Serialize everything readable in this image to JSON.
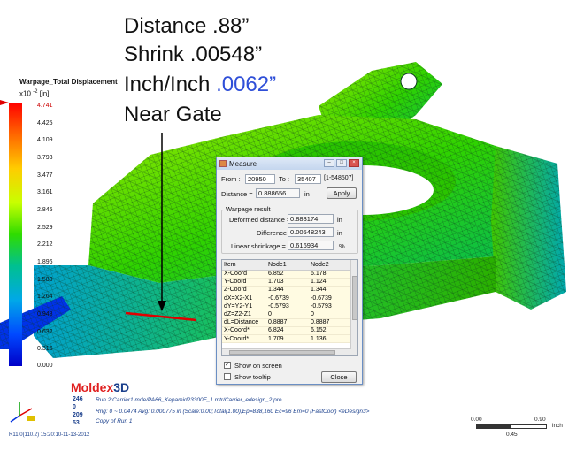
{
  "annotation": {
    "line1": "Distance .88”",
    "line2": "Shrink .00548”",
    "line3_prefix": "Inch/Inch ",
    "line3_highlight": ".0062”",
    "line4": "Near Gate"
  },
  "legend": {
    "title": "Warpage_Total Displacement",
    "unit_prefix": "x10",
    "unit_exp": "-2",
    "unit": "[in]",
    "ticks": [
      "4.741",
      "4.425",
      "4.109",
      "3.793",
      "3.477",
      "3.161",
      "2.845",
      "2.529",
      "2.212",
      "1.896",
      "1.580",
      "1.264",
      "0.948",
      "0.632",
      "0.316",
      "0.000"
    ]
  },
  "dialog": {
    "title": "Measure",
    "from_label": "From :",
    "from_value": "20950",
    "to_label": "To :",
    "to_value": "35407",
    "range_text": "[1-548507]",
    "distance_label": "Distance =",
    "distance_value": "0.888656",
    "distance_unit": "in",
    "apply_label": "Apply",
    "group_title": "Warpage result",
    "deformed_label": "Deformed distance =",
    "deformed_value": "0.883174",
    "deformed_unit": "in",
    "difference_label": "Difference =",
    "difference_value": "0.00548243",
    "difference_unit": "in",
    "shrinkage_label": "Linear shrinkage =",
    "shrinkage_value": "0.616934",
    "shrinkage_unit": "%",
    "table_headers": [
      "Item",
      "Node1",
      "Node2"
    ],
    "table_rows": [
      [
        "X-Coord",
        "6.852",
        "6.178"
      ],
      [
        "Y-Coord",
        "1.703",
        "1.124"
      ],
      [
        "Z-Coord",
        "1.344",
        "1.344"
      ],
      [
        "dX=X2-X1",
        "-0.6739",
        "-0.6739"
      ],
      [
        "dY=Y2-Y1",
        "-0.5793",
        "-0.5793"
      ],
      [
        "dZ=Z2-Z1",
        "0",
        "0"
      ],
      [
        "dL=Distance",
        "0.8887",
        "0.8887"
      ],
      [
        "X-Coord*",
        "6.824",
        "6.152"
      ],
      [
        "Y-Coord*",
        "1.709",
        "1.136"
      ]
    ],
    "show_on_screen_label": "Show on screen",
    "show_on_screen_checked": true,
    "show_tooltip_label": "Show tooltip",
    "show_tooltip_checked": false,
    "close_label": "Close"
  },
  "footer": {
    "brand_a": "Moldex",
    "brand_b": "3D",
    "nums": [
      "246",
      "0",
      "209",
      "53"
    ],
    "info1": "Run 2:Carrier1.mde/PA66_Kepamid23300F_1.mtr/Carrier_edesign_2.pro",
    "info2": "Rng: 0 ~ 0.0474   Avg: 0.000775 in (Scale:0.00;Total(1.00),Ep=838,160 Ec=96 Em=0 (FastCool)  <eDesign3>",
    "info3": "Copy of Run 1",
    "version": "R11.0(110.2) 15:20:10-11-13-2012"
  },
  "scale": {
    "left": "0.00",
    "mid": "0.45",
    "right": "0.90",
    "unit": "inch"
  }
}
